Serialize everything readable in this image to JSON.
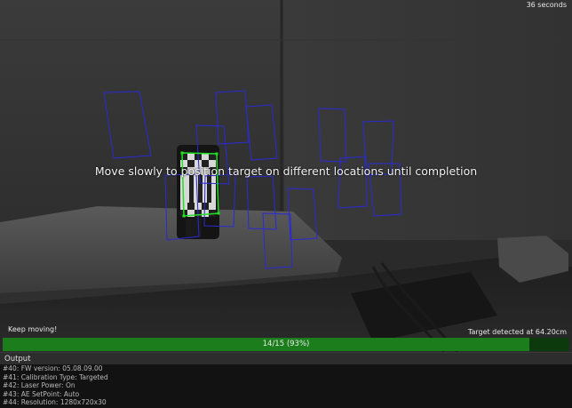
{
  "overlay": {
    "timer": "36 seconds",
    "instruction": "Move slowly to position target on different locations until completion",
    "status_left": "Keep moving!",
    "status_right": "Target detected at 64.20cm"
  },
  "progress": {
    "label": "14/15 (93%)",
    "fraction": 0.93,
    "fill_color": "#1b7d1b"
  },
  "output": {
    "title": "Output",
    "lines": [
      "#40: FW version: 05.08.09.00",
      "#41: Calibration Type: Targeted",
      "#42: Laser Power: On",
      "#43: AE SetPoint: Auto",
      "#44: Resolution: 1280x720x30"
    ]
  },
  "colors": {
    "target_box": "#2a2ad6",
    "active_target": "#22e022",
    "progress_bg": "#0d3a0d"
  }
}
